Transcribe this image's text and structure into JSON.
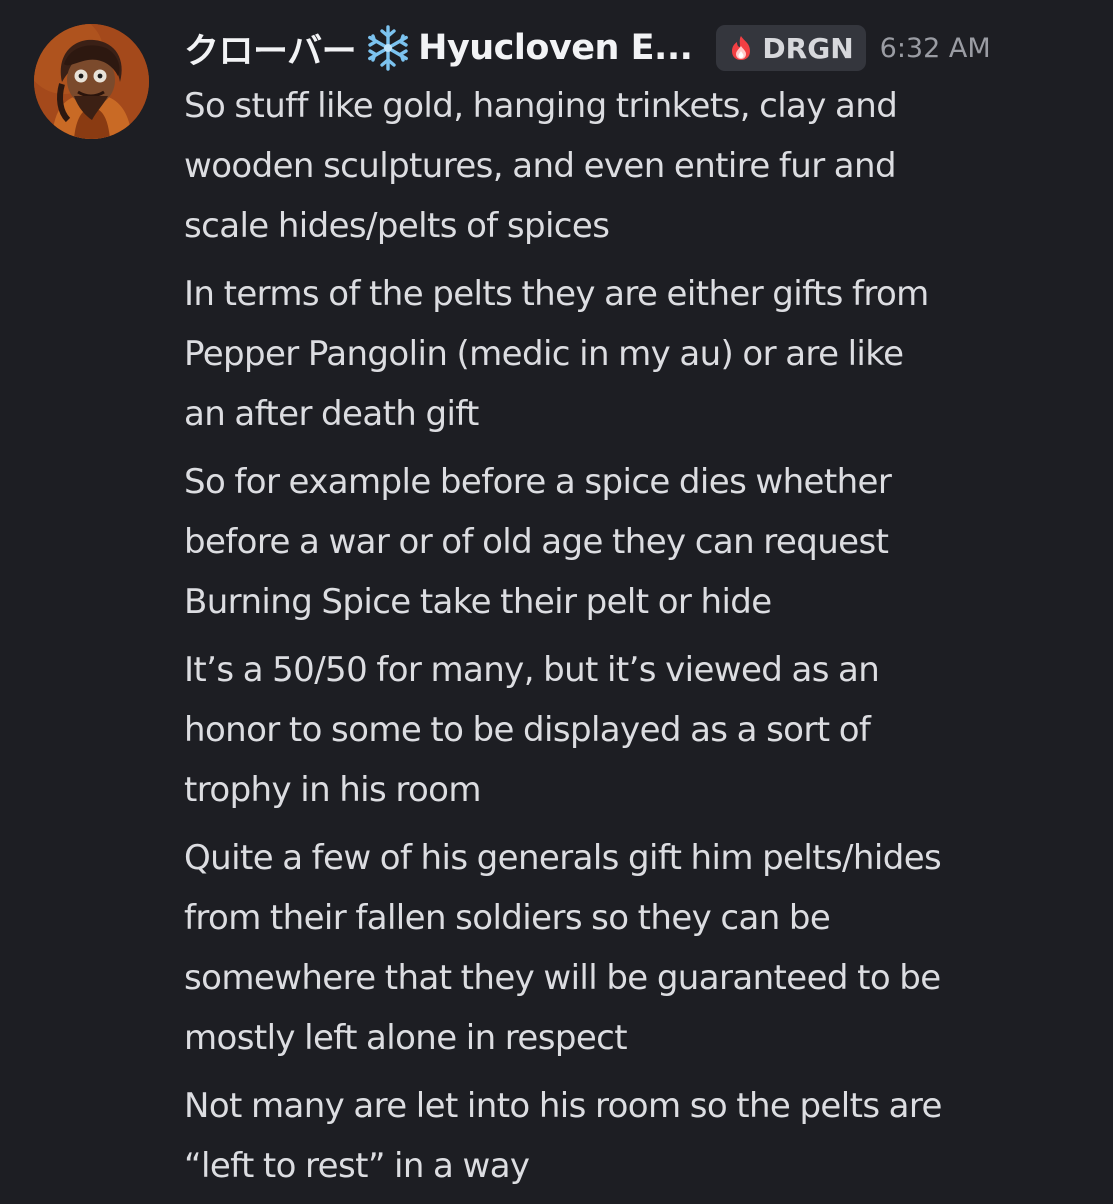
{
  "author": {
    "name": "クローバー",
    "name_suffix": "Hyucloven E...",
    "avatar_icon": "character-avatar",
    "badge_icon": "snowflake-icon"
  },
  "tag": {
    "icon": "fire-icon",
    "label": "DRGN"
  },
  "timestamp": "6:32 AM",
  "messages": [
    {
      "lines": [
        "So stuff like gold, hanging trinkets, clay and",
        "wooden sculptures, and even entire fur and",
        "scale hides/pelts of spices"
      ]
    },
    {
      "lines": [
        "In terms of the pelts they are either gifts from",
        "Pepper Pangolin (medic in my au) or are like",
        "an after death gift"
      ]
    },
    {
      "lines": [
        "So for example before a spice dies whether",
        "before a war or of old age they can request",
        "Burning Spice take their pelt or hide"
      ]
    },
    {
      "lines": [
        "It’s a 50/50 for many, but it’s viewed as an",
        "honor to some to be displayed as a sort of",
        "trophy in his room"
      ]
    },
    {
      "lines": [
        "Quite a few of his generals gift him pelts/hides",
        "from their fallen soldiers so they can be",
        "somewhere that they will be guaranteed to be",
        "mostly left alone in respect"
      ]
    },
    {
      "lines": [
        "Not many are let into his room so the pelts are",
        "“left to rest” in a way"
      ]
    }
  ],
  "colors": {
    "background": "#1d1e23",
    "username": "#f2f3f5",
    "message_text": "#dcdde1",
    "timestamp": "#9a9ca3",
    "tag_background": "#34363d"
  }
}
